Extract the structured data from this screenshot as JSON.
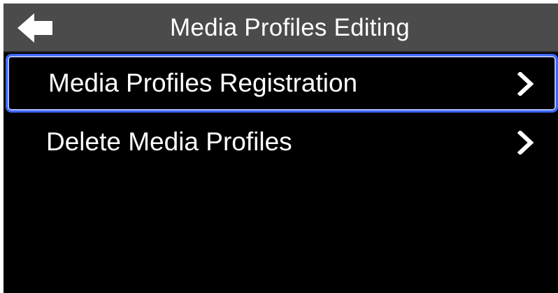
{
  "header": {
    "title": "Media Profiles Editing",
    "back_icon": "back-arrow-icon"
  },
  "menu": {
    "items": [
      {
        "label": "Media Profiles Registration",
        "icon": "chevron-right-icon",
        "selected": true
      },
      {
        "label": "Delete Media Profiles",
        "icon": "chevron-right-icon",
        "selected": false
      }
    ]
  },
  "colors": {
    "background": "#000000",
    "header": "#4b4b4b",
    "selection_border": "#3c67ff",
    "text": "#ffffff"
  }
}
